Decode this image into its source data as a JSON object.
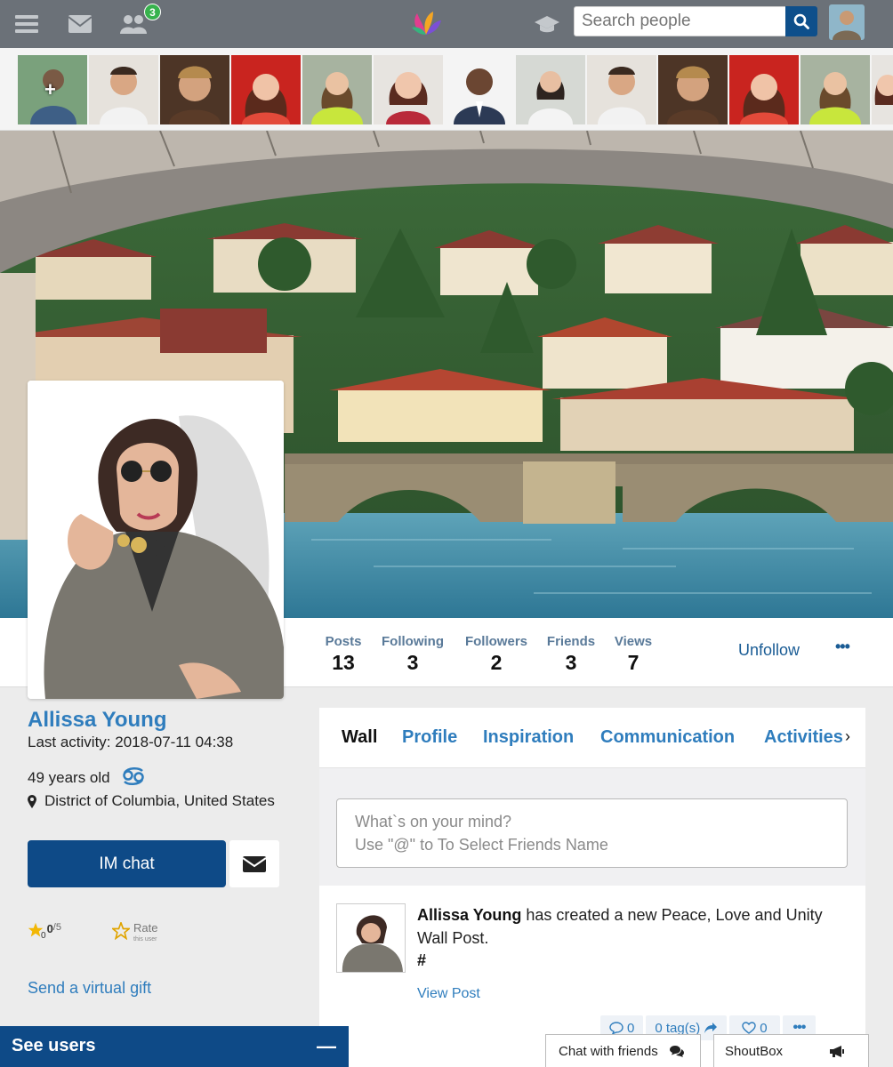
{
  "topbar": {
    "friend_requests_badge": "3",
    "search_placeholder": "Search people"
  },
  "stats": [
    {
      "label": "Posts",
      "value": "13"
    },
    {
      "label": "Following",
      "value": "3"
    },
    {
      "label": "Followers",
      "value": "2"
    },
    {
      "label": "Friends",
      "value": "3"
    },
    {
      "label": "Views",
      "value": "7"
    }
  ],
  "actions": {
    "unfollow": "Unfollow",
    "more": "•••"
  },
  "profile": {
    "name": "Allissa Young",
    "last_activity": "Last activity: 2018-07-11 04:38",
    "age": "49 years old",
    "location": "District of Columbia, United States",
    "im_chat": "IM chat",
    "rating_value": "0",
    "rating_sub": "0",
    "rating_max": "/5",
    "rate_label": "Rate",
    "rate_sub": "this user",
    "gift": "Send a virtual gift"
  },
  "tabs": [
    {
      "label": "Wall"
    },
    {
      "label": "Profile"
    },
    {
      "label": "Inspiration"
    },
    {
      "label": "Communication"
    },
    {
      "label": "Activities"
    }
  ],
  "composer": {
    "line1": "What`s on your mind?",
    "line2": "Use \"@\" to To Select Friends Name"
  },
  "post": {
    "author": "Allissa Young",
    "text": " has created a new Peace, Love and Unity Wall Post.",
    "hash": "#",
    "view_post": "View Post",
    "comments": "0",
    "tags": "0 tag(s)",
    "likes": "0",
    "more": "•••"
  },
  "bottom": {
    "see_users": "See users",
    "chat": "Chat with friends",
    "shoutbox": "ShoutBox"
  },
  "colors": {
    "topbar": "#6b7178",
    "primary": "#0e4a87",
    "link": "#2f7dbd"
  }
}
